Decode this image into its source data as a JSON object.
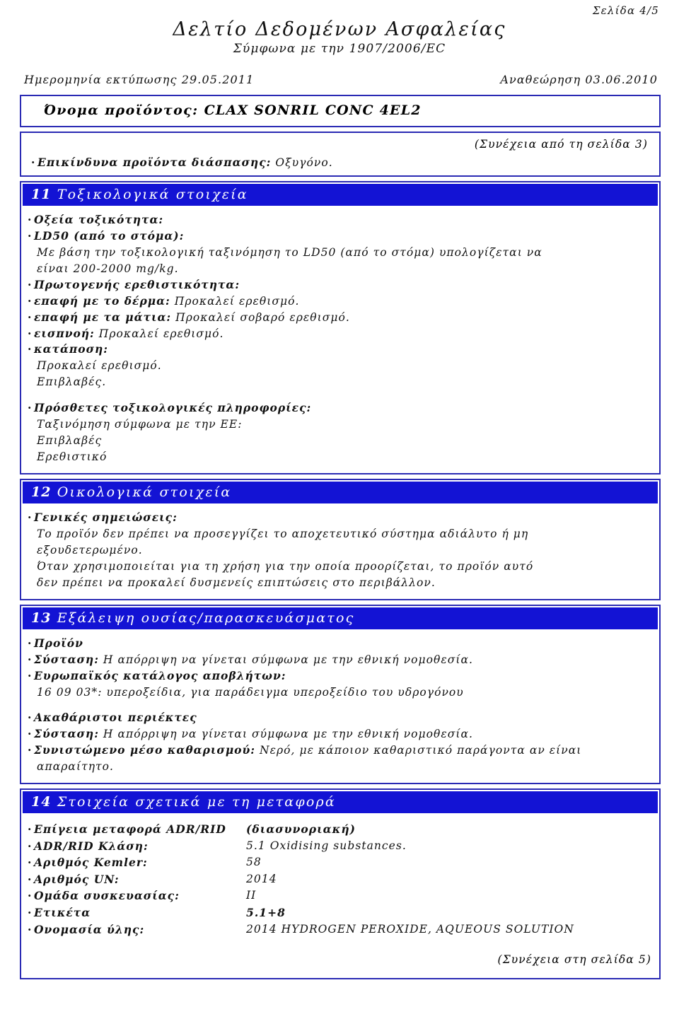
{
  "header": {
    "page_indicator": "Σελίδα 4/5",
    "title": "Δελτίο Δεδομένων Ασφαλείας",
    "subtitle": "Σύμφωνα με την 1907/2006/EC",
    "print_date": "Ημερομηνία εκτύπωσης 29.05.2011",
    "revision": "Αναθεώρηση 03.06.2010"
  },
  "product": {
    "label": "Όνομα προϊόντος:",
    "name": "CLAX SONRIL CONC 4EL2"
  },
  "continued": {
    "from": "(Συνέχεια από τη σελίδα 3)",
    "to": "(Συνέχεια στη σελίδα 5)"
  },
  "carryover": {
    "label": "Επικίνδυνα προϊόντα διάσπασης:",
    "value": "Οξυγόνο."
  },
  "colors": {
    "section_bar_bg": "#1313d4",
    "section_bar_text": "#ffffff",
    "box_border": "#2a2ab4",
    "body_text": "#111111"
  },
  "sections": {
    "s11": {
      "num": "11",
      "title": "Τοξικολογικά στοιχεία",
      "l1": "Οξεία τοξικότητα:",
      "l2": "LD50 (από το στόμα):",
      "l3": "Με βάση την τοξικολογική ταξινόμηση το LD50 (από το στόμα) υπολογίζεται να",
      "l4": "είναι 200-2000 mg/kg.",
      "l5": "Πρωτογενής ερεθιστικότητα:",
      "l6_lbl": "επαφή με το δέρμα:",
      "l6_val": "Προκαλεί ερεθισμό.",
      "l7_lbl": "επαφή με τα μάτια:",
      "l7_val": "Προκαλεί σοβαρό ερεθισμό.",
      "l8_lbl": "εισπνοή:",
      "l8_val": "Προκαλεί ερεθισμό.",
      "l9": "κατάποση:",
      "l10": "Προκαλεί ερεθισμό.",
      "l11": "Επιβλαβές.",
      "l12": "Πρόσθετες τοξικολογικές πληροφορίες:",
      "l13": "Ταξινόμηση σύμφωνα με την ΕΕ:",
      "l14": "Επιβλαβές",
      "l15": "Ερεθιστικό"
    },
    "s12": {
      "num": "12",
      "title": "Οικολογικά στοιχεία",
      "l1": "Γενικές σημειώσεις:",
      "l2": "Το προϊόν δεν πρέπει να προσεγγίζει το αποχετευτικό σύστημα αδιάλυτο ή μη",
      "l3": "εξουδετερωμένο.",
      "l4": "Όταν χρησιμοποιείται για τη χρήση για την οποία προορίζεται, το προϊόν αυτό",
      "l5": "δεν πρέπει να προκαλεί δυσμενείς επιπτώσεις στο περιβάλλον."
    },
    "s13": {
      "num": "13",
      "title": "Εξάλειψη ουσίας/παρασκευάσματος",
      "l1": "Προϊόν",
      "l2_lbl": "Σύσταση:",
      "l2_val": "Η απόρριψη να γίνεται σύμφωνα με την εθνική νομοθεσία.",
      "l3": "Ευρωπαϊκός κατάλογος αποβλήτων:",
      "l4": "16 09 03*: υπεροξείδια, για παράδειγμα υπεροξείδιο του υδρογόνου",
      "l5": "Ακαθάριστοι περιέκτες",
      "l6_lbl": "Σύσταση:",
      "l6_val": "Η απόρριψη να γίνεται σύμφωνα με την εθνική νομοθεσία.",
      "l7_lbl": "Συνιστώμενο μέσο καθαρισμού:",
      "l7_val": "Νερό, με κάποιον καθαριστικό παράγοντα αν είναι",
      "l8": "απαραίτητο."
    },
    "s14": {
      "num": "14",
      "title": "Στοιχεία σχετικά με τη μεταφορά",
      "rows": [
        {
          "key": "Επίγεια μεταφορά ADR/RID",
          "value": "(διασυνοριακή)",
          "bold_value": true
        },
        {
          "key": "ADR/RID Κλάση:",
          "value": "5.1 Oxidising substances.",
          "bold_value": false
        },
        {
          "key": "Αριθμός Kemler:",
          "value": "58",
          "bold_value": false
        },
        {
          "key": "Αριθμός UN:",
          "value": "2014",
          "bold_value": false
        },
        {
          "key": "Ομάδα συσκευασίας:",
          "value": "II",
          "bold_value": false
        },
        {
          "key": "Ετικέτα",
          "value": "5.1+8",
          "bold_value": true
        },
        {
          "key": "Ονομασία ύλης:",
          "value": "2014 HYDROGEN PEROXIDE, AQUEOUS SOLUTION",
          "bold_value": false
        }
      ]
    }
  }
}
